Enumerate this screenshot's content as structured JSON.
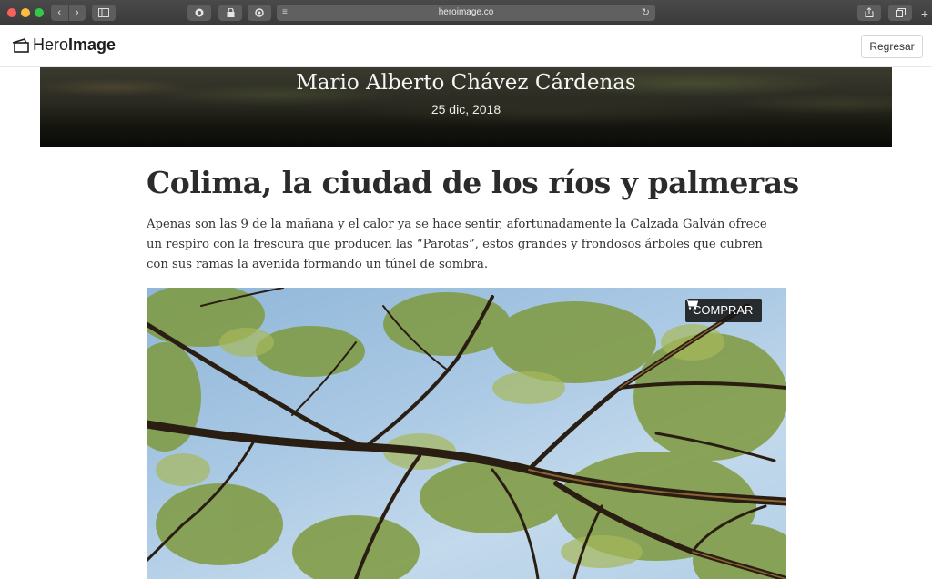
{
  "browser": {
    "url": "heroimage.co",
    "back_glyph": "‹",
    "forward_glyph": "›",
    "reload_glyph": "↻",
    "plus_glyph": "+",
    "icons": [
      "back-icon",
      "forward-icon",
      "sidebar-icon",
      "extension-icon",
      "lock-icon",
      "settings-icon",
      "reader-icon",
      "reload-icon",
      "share-icon",
      "tabs-icon",
      "new-tab-icon"
    ]
  },
  "header": {
    "logo_light": "Hero",
    "logo_bold": "Image",
    "back_label": "Regresar"
  },
  "hero": {
    "author": "Mario Alberto Chávez Cárdenas",
    "date": "25 dic, 2018"
  },
  "article": {
    "title": "Colima, la ciudad de los ríos y palmeras",
    "body": "Apenas son las 9 de la mañana y el calor ya se hace sentir, afortunadamente la Calzada Galván ofrece un respiro con la frescura que producen las “Parotas”, estos grandes y frondosos árboles que cubren con sus ramas la avenida formando un túnel de sombra."
  },
  "photo": {
    "buy_label": "COMPRAR",
    "buy_icon": "cart-icon"
  },
  "colors": {
    "sky": "#a9c8e4",
    "foliage": "#7f9a3e",
    "branch": "#2a1d12",
    "hero_dark": "#15150f"
  }
}
